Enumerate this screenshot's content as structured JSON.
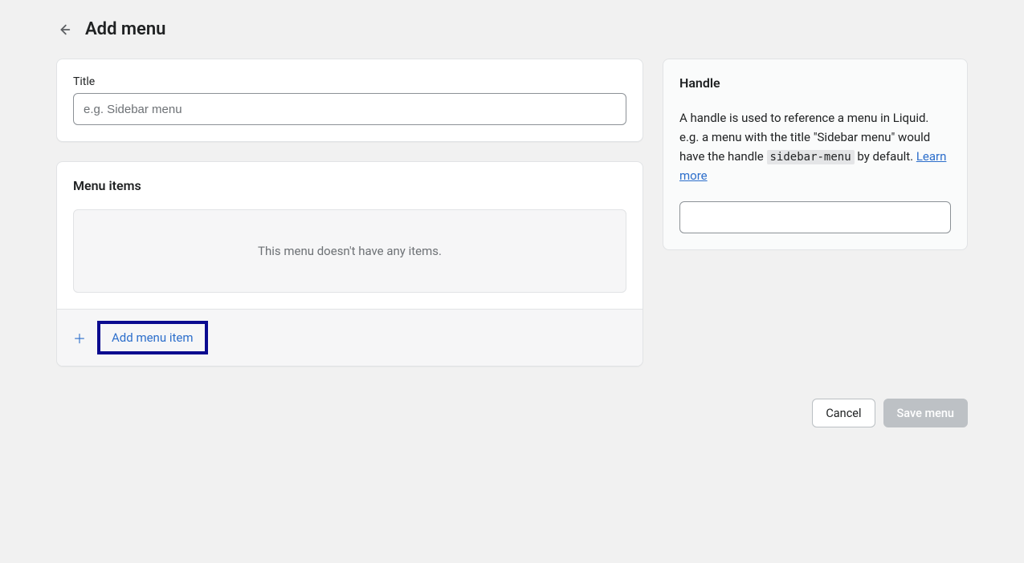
{
  "header": {
    "title": "Add menu"
  },
  "title_card": {
    "label": "Title",
    "placeholder": "e.g. Sidebar menu",
    "value": ""
  },
  "menu_items": {
    "section_title": "Menu items",
    "empty_text": "This menu doesn't have any items.",
    "add_label": "Add menu item"
  },
  "handle": {
    "title": "Handle",
    "desc_pre": "A handle is used to reference a menu in Liquid. e.g. a menu with the title \"Sidebar menu\" would have the handle ",
    "code": "sidebar-menu",
    "desc_post": " by default. ",
    "learn_more": "Learn more",
    "value": ""
  },
  "actions": {
    "cancel": "Cancel",
    "save": "Save menu"
  }
}
